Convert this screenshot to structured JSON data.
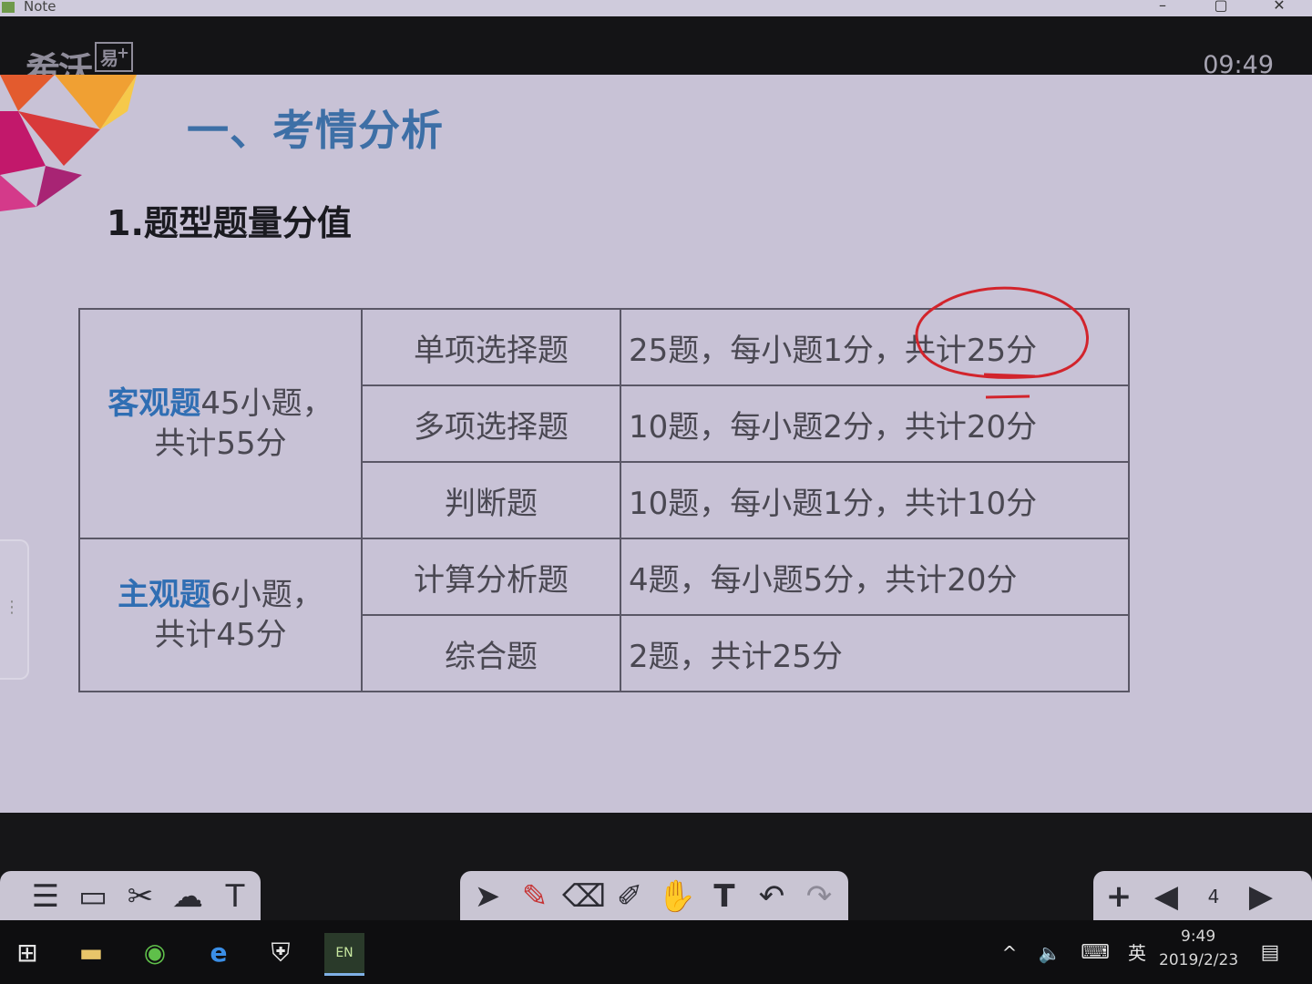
{
  "window": {
    "title": "Note",
    "minimize": "–",
    "restore": "▢",
    "close": "✕"
  },
  "header": {
    "logo_text": "希沃",
    "logo_badge": "易",
    "logo_plus": "+",
    "clock": "09:49"
  },
  "slide": {
    "title": "一、考情分析",
    "subtitle": "1.题型题量分值",
    "groups": [
      {
        "category_highlight": "客观题",
        "category_rest": "45小题，",
        "category_line2": "共计55分",
        "rows": [
          {
            "type": "单项选择题",
            "desc": "25题，每小题1分，共计25分"
          },
          {
            "type": "多项选择题",
            "desc": "10题，每小题2分，共计20分"
          },
          {
            "type": "判断题",
            "desc": "10题，每小题1分，共计10分"
          }
        ]
      },
      {
        "category_highlight": "主观题",
        "category_rest": "6小题，",
        "category_line2": "共计45分",
        "rows": [
          {
            "type": "计算分析题",
            "desc": "4题，每小题5分，共计20分"
          },
          {
            "type": "综合题",
            "desc": "2题，共计25分"
          }
        ]
      }
    ],
    "annotation_color": "#d2242c"
  },
  "board_toolbar": {
    "left_tools": [
      "menu-icon",
      "monitor-icon",
      "tools-icon",
      "cloud-icon",
      "text-tool-icon"
    ],
    "center_tools": [
      "select-icon",
      "pen-icon",
      "eraser-icon",
      "brush-icon",
      "hand-icon",
      "text-icon",
      "undo-icon",
      "redo-icon"
    ],
    "right_tools": [
      "add-page-icon",
      "prev-page-icon",
      "page-count-icon",
      "next-page-icon"
    ],
    "page_badge": "4"
  },
  "taskbar": {
    "apps": [
      "windows-start-icon",
      "file-explorer-icon",
      "browser-360-icon",
      "edge-icon",
      "security-shield-icon",
      "easinote-icon"
    ],
    "easinote_label": "EN",
    "tray": {
      "ime": "英",
      "time": "9:49",
      "date": "2019/2/23"
    }
  }
}
